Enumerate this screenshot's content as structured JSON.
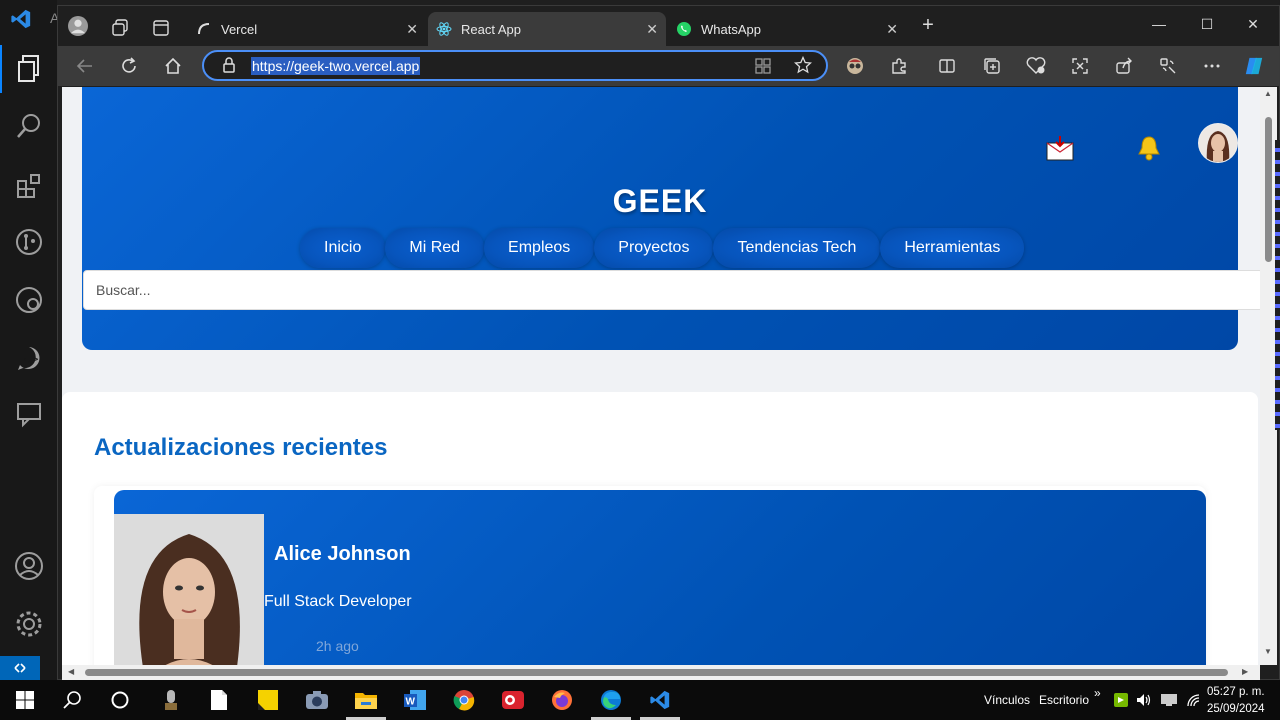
{
  "vscode": {
    "title_fragment": "A"
  },
  "tabs": [
    {
      "title": "Vercel",
      "icon": "vercel-icon"
    },
    {
      "title": "React App",
      "icon": "react-icon"
    },
    {
      "title": "WhatsApp",
      "icon": "whatsapp-icon"
    }
  ],
  "address_bar": {
    "url": "https://geek-two.vercel.app"
  },
  "page": {
    "brand": "GEEK",
    "nav": [
      "Inicio",
      "Mi Red",
      "Empleos",
      "Proyectos",
      "Tendencias Tech",
      "Herramientas"
    ],
    "search_placeholder": "Buscar...",
    "updates_title": "Actualizaciones recientes",
    "post": {
      "name": "Alice Johnson",
      "role": "Full Stack Developer",
      "time": "2h ago"
    }
  },
  "taskbar": {
    "links_label": "Vínculos",
    "desktop_label": "Escritorio",
    "time": "05:27 p. m.",
    "date": "25/09/2024"
  },
  "colors": {
    "primary": "#0052b4",
    "accent": "#0a66c2",
    "taskbar": "#0b0b0b"
  }
}
